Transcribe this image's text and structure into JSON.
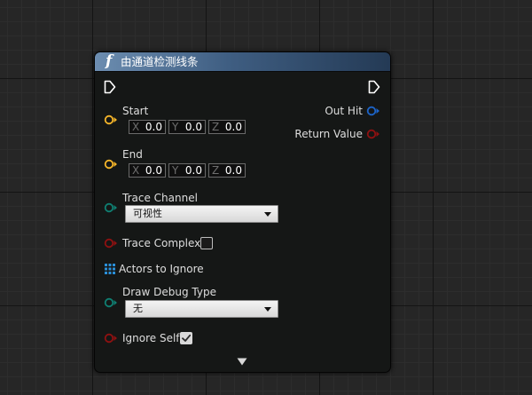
{
  "node": {
    "title": "由通道检测线条",
    "function_glyph": "f",
    "header_gradient": [
      "#6c8db0",
      "#243a55"
    ],
    "inputs": {
      "start": {
        "label": "Start",
        "x": "0.0",
        "y": "0.0",
        "z": "0.0"
      },
      "end": {
        "label": "End",
        "x": "0.0",
        "y": "0.0",
        "z": "0.0"
      },
      "trace_channel": {
        "label": "Trace Channel",
        "value": "可视性"
      },
      "trace_complex": {
        "label": "Trace Complex",
        "checked": false
      },
      "actors_to_ignore": {
        "label": "Actors to Ignore"
      },
      "draw_debug_type": {
        "label": "Draw Debug Type",
        "value": "无"
      },
      "ignore_self": {
        "label": "Ignore Self",
        "checked": true
      }
    },
    "outputs": {
      "out_hit": {
        "label": "Out Hit"
      },
      "return_value": {
        "label": "Return Value"
      }
    },
    "axis_labels": {
      "x": "X",
      "y": "Y",
      "z": "Z"
    },
    "pin_colors": {
      "vector": "#f5b529",
      "enum": "#0f7f72",
      "bool": "#8f1111",
      "actor_array": "#2a8fd8",
      "struct": "#1d64c8"
    }
  }
}
